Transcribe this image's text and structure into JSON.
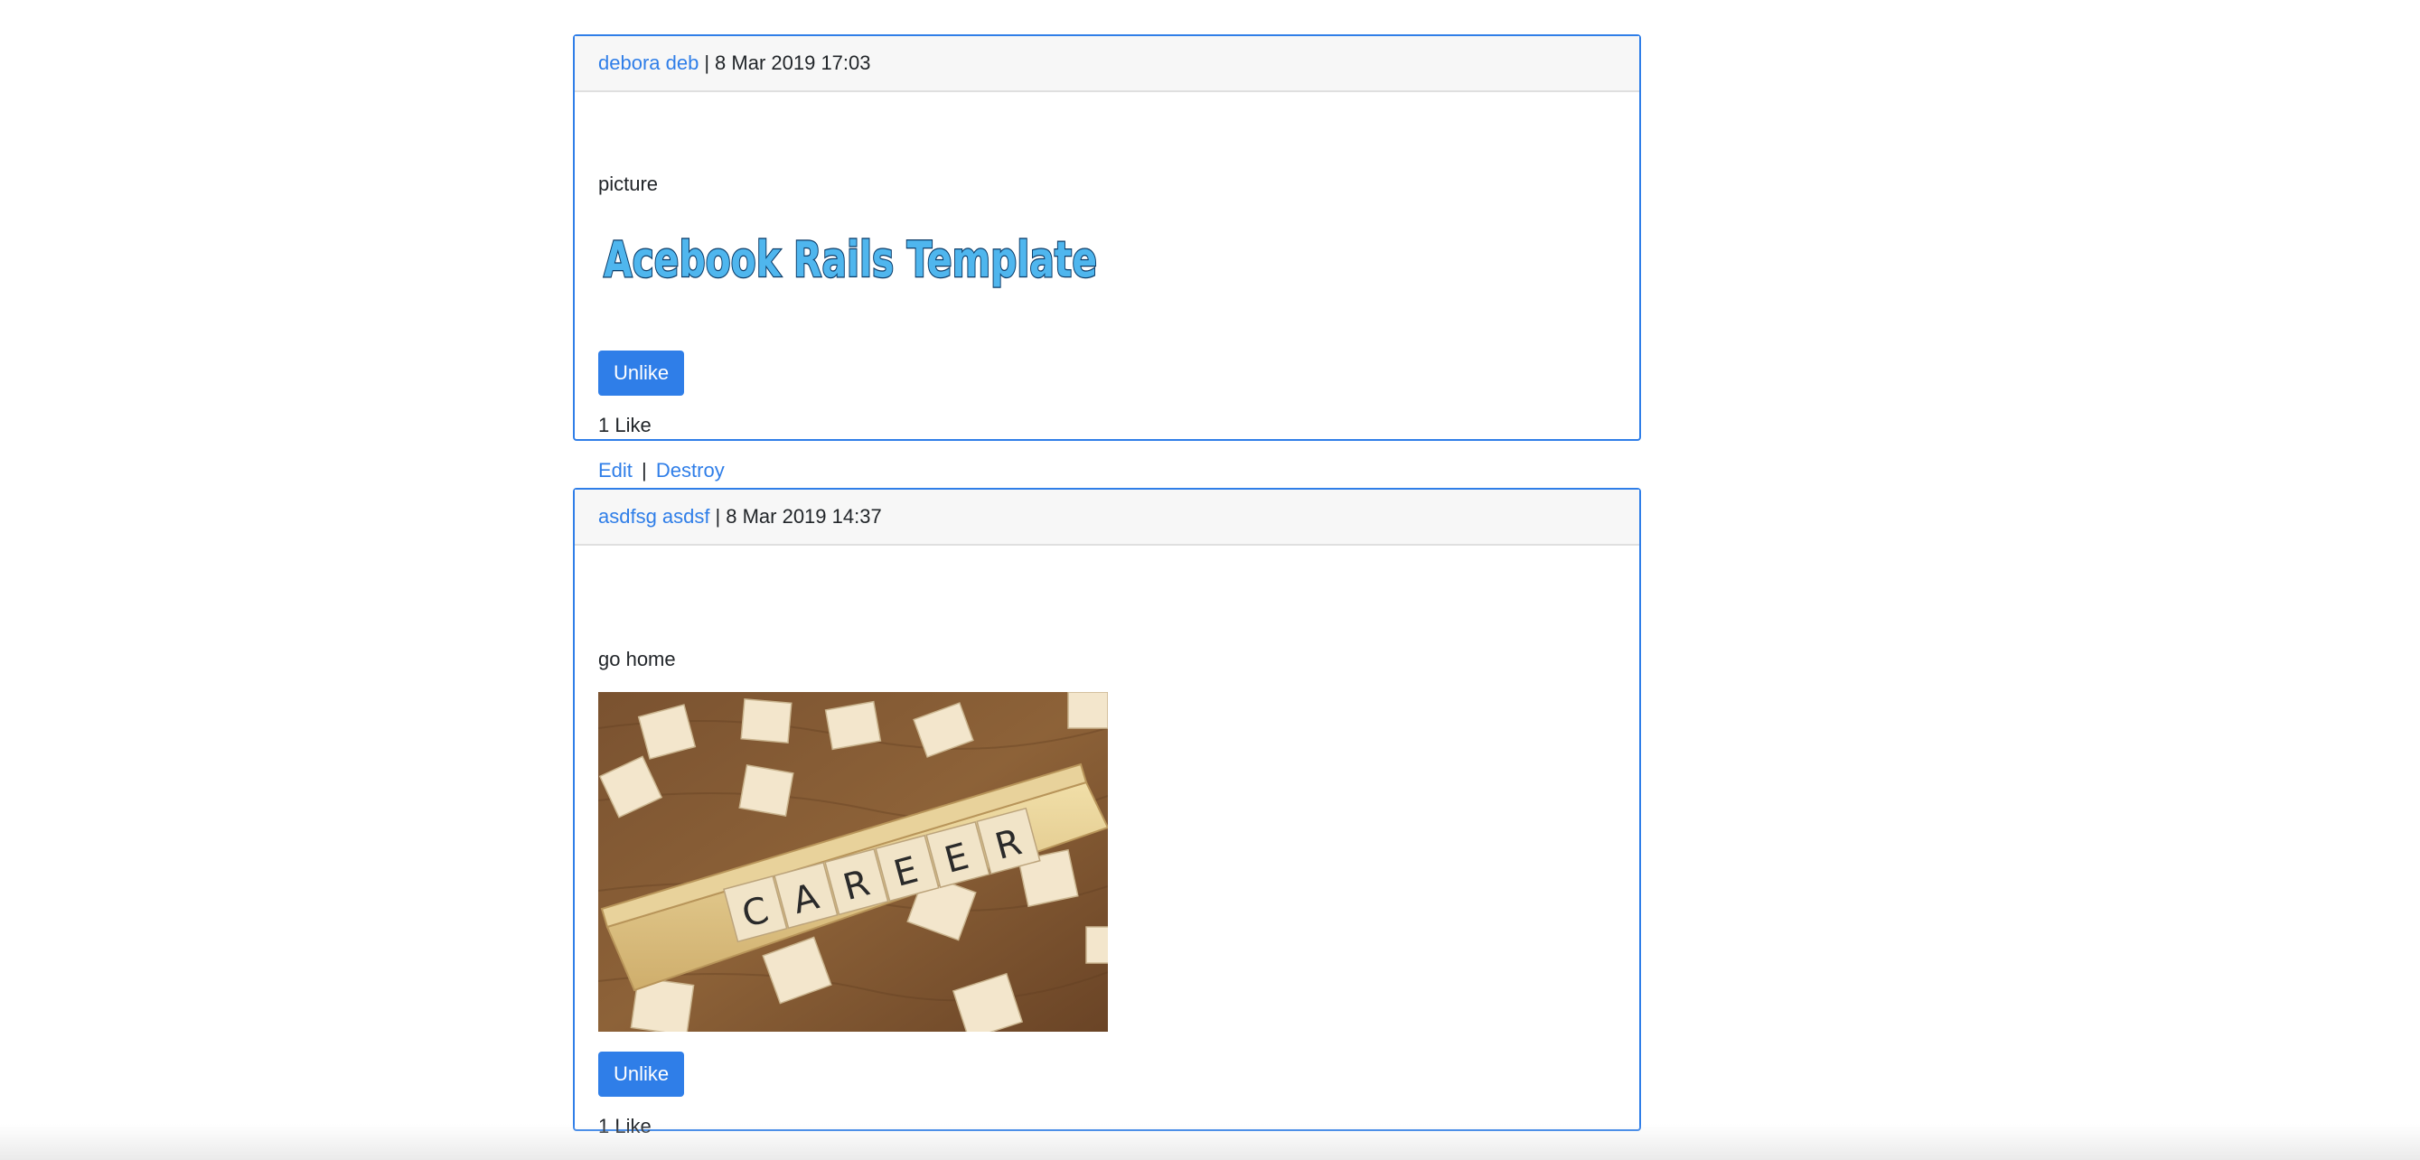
{
  "posts": [
    {
      "author": "debora deb",
      "separator": "|",
      "timestamp": "8 Mar 2019 17:03",
      "text": "picture",
      "image_text": "Acebook Rails Template",
      "like_button": "Unlike",
      "likes_count": "1 Like",
      "edit_link": "Edit",
      "actions_separator": "|",
      "destroy_link": "Destroy"
    },
    {
      "author": "asdfsg asdsf",
      "separator": "|",
      "timestamp": "8 Mar 2019 14:37",
      "text": "go home",
      "image_tiles": [
        "C",
        "A",
        "R",
        "E",
        "E",
        "R"
      ],
      "like_button": "Unlike",
      "likes_count": "1 Like"
    }
  ],
  "colors": {
    "accent": "#2f7ee8",
    "header_bg": "#f7f7f7"
  }
}
